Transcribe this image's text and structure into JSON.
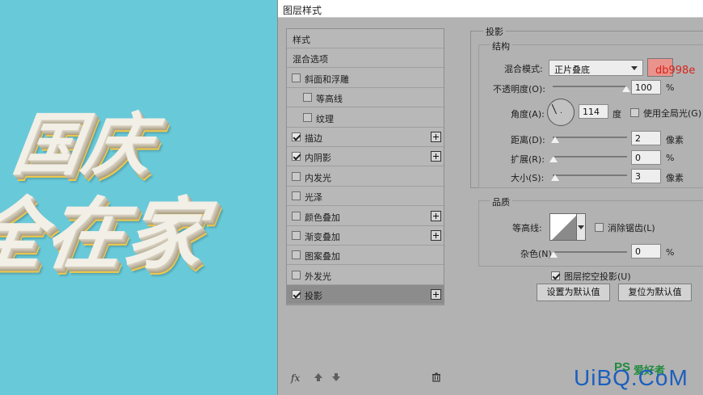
{
  "canvas": {
    "line1": "国庆",
    "line2": "全在家"
  },
  "dialog": {
    "title": "图层样式",
    "style_list": {
      "items": [
        {
          "label": "样式",
          "checkbox": false,
          "checked": false,
          "plus": false,
          "selected": false
        },
        {
          "label": "混合选项",
          "checkbox": false,
          "checked": false,
          "plus": false,
          "selected": false
        },
        {
          "label": "斜面和浮雕",
          "checkbox": true,
          "checked": false,
          "plus": false,
          "selected": false
        },
        {
          "label": "等高线",
          "checkbox": true,
          "checked": false,
          "plus": false,
          "selected": false,
          "indent": true
        },
        {
          "label": "纹理",
          "checkbox": true,
          "checked": false,
          "plus": false,
          "selected": false,
          "indent": true
        },
        {
          "label": "描边",
          "checkbox": true,
          "checked": true,
          "plus": true,
          "selected": false
        },
        {
          "label": "内阴影",
          "checkbox": true,
          "checked": true,
          "plus": true,
          "selected": false
        },
        {
          "label": "内发光",
          "checkbox": true,
          "checked": false,
          "plus": false,
          "selected": false
        },
        {
          "label": "光泽",
          "checkbox": true,
          "checked": false,
          "plus": false,
          "selected": false
        },
        {
          "label": "颜色叠加",
          "checkbox": true,
          "checked": false,
          "plus": true,
          "selected": false
        },
        {
          "label": "渐变叠加",
          "checkbox": true,
          "checked": false,
          "plus": true,
          "selected": false
        },
        {
          "label": "图案叠加",
          "checkbox": true,
          "checked": false,
          "plus": false,
          "selected": false
        },
        {
          "label": "外发光",
          "checkbox": true,
          "checked": false,
          "plus": false,
          "selected": false
        },
        {
          "label": "投影",
          "checkbox": true,
          "checked": true,
          "plus": true,
          "selected": true
        }
      ],
      "footer": {
        "fx": "fx",
        "up_icon": "arrow-up-icon",
        "down_icon": "arrow-down-icon",
        "trash_icon": "trash-icon"
      }
    },
    "drop_shadow": {
      "section_title": "投影",
      "structure": {
        "title": "结构",
        "blend_mode_label": "混合模式:",
        "blend_mode_value": "正片叠底",
        "color_swatch": "#e9938c",
        "color_hex_label": "db998e",
        "opacity_label": "不透明度(O):",
        "opacity_value": "100",
        "opacity_unit": "%",
        "angle_label": "角度(A):",
        "angle_value": "114",
        "angle_unit": "度",
        "global_light_label": "使用全局光(G)",
        "global_light_checked": false,
        "distance_label": "距离(D):",
        "distance_value": "2",
        "distance_unit": "像素",
        "spread_label": "扩展(R):",
        "spread_value": "0",
        "spread_unit": "%",
        "size_label": "大小(S):",
        "size_value": "3",
        "size_unit": "像素"
      },
      "quality": {
        "title": "品质",
        "contour_label": "等高线:",
        "anti_alias_label": "消除锯齿(L)",
        "anti_alias_checked": false,
        "noise_label": "杂色(N):",
        "noise_value": "0",
        "noise_unit": "%"
      },
      "knockout_label": "图层挖空投影(U)",
      "knockout_checked": true,
      "set_default_label": "设置为默认值",
      "reset_default_label": "复位为默认值"
    }
  },
  "watermark": {
    "main": "UiBQ.CoM",
    "ps": "PS",
    "sub": "爱好者"
  }
}
